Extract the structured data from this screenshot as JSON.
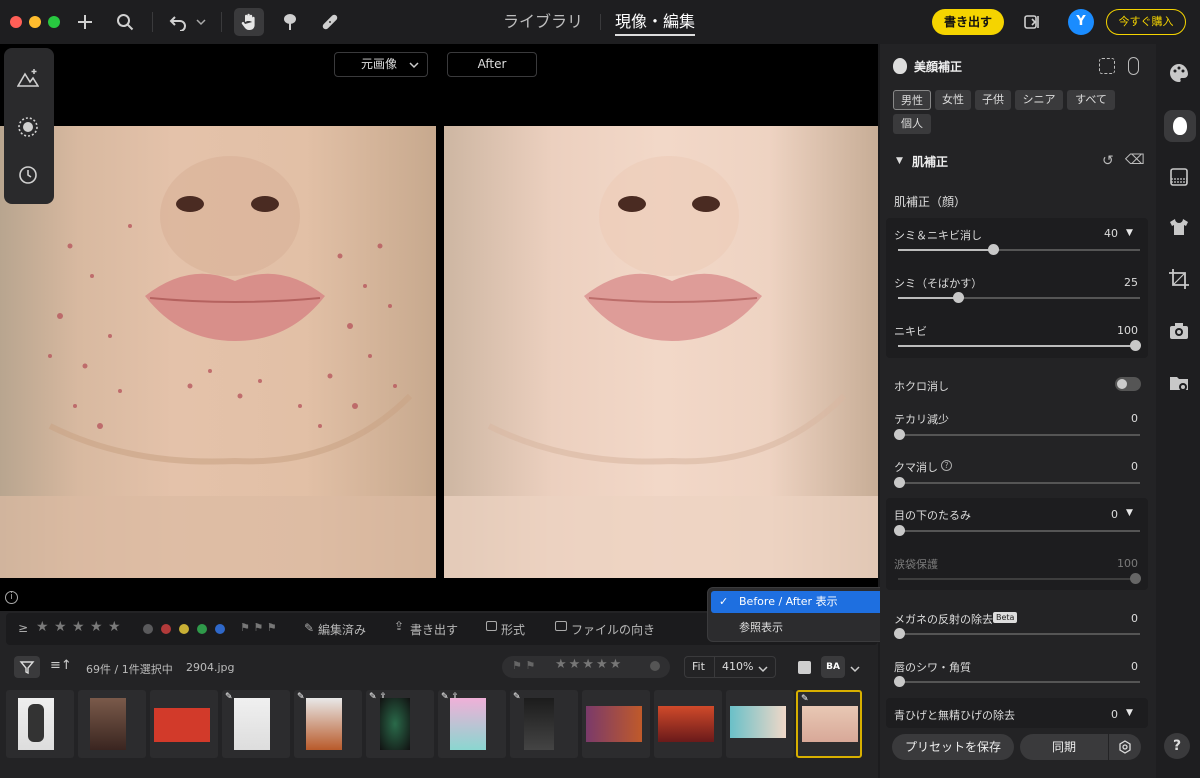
{
  "topbar": {
    "tab_library": "ライブラリ",
    "tab_develop": "現像・編集",
    "export_label": "書き出す",
    "avatar_letter": "Y",
    "buy_label": "今すぐ購入"
  },
  "viewer": {
    "before_select": "元画像",
    "after_label": "After"
  },
  "filter_bar": {
    "edited": "編集済み",
    "export": "書き出す",
    "format": "形式",
    "orientation": "ファイルの向き"
  },
  "film_info": {
    "count": "69件 / 1件選択中",
    "filename": "2904.jpg",
    "fit": "Fit",
    "zoom": "410%"
  },
  "view_menu": {
    "items": [
      {
        "label": "Before / After 表示",
        "selected": true
      },
      {
        "label": "参照表示",
        "selected": false
      }
    ]
  },
  "panel": {
    "title": "美顔補正",
    "chips": [
      "男性",
      "女性",
      "子供",
      "シニア",
      "すべて",
      "個人"
    ],
    "section_skin": "肌補正",
    "subsection_face": "肌補正（顔）",
    "sliders": [
      {
        "label": "シミ＆ニキビ消し",
        "value": "40"
      },
      {
        "label": "シミ（そばかす）",
        "value": "25"
      },
      {
        "label": "ニキビ",
        "value": "100"
      },
      {
        "label": "テカリ減少",
        "value": "0"
      },
      {
        "label": "クマ消し",
        "value": "0"
      },
      {
        "label": "目の下のたるみ",
        "value": "0"
      },
      {
        "label": "涙袋保護",
        "value": "100"
      },
      {
        "label": "メガネの反射の除去",
        "value": "0"
      },
      {
        "label": "唇のシワ・角質",
        "value": "0"
      },
      {
        "label": "青ひげと無精ひげの除去",
        "value": "0"
      }
    ],
    "mole_toggle": "ホクロ消し",
    "beta_badge": "Beta",
    "save_preset": "プリセットを保存",
    "sync": "同期"
  },
  "colors": {
    "accent_yellow": "#f5d400",
    "accent_blue": "#1e6fe0",
    "avatar_blue": "#1a8cff"
  }
}
